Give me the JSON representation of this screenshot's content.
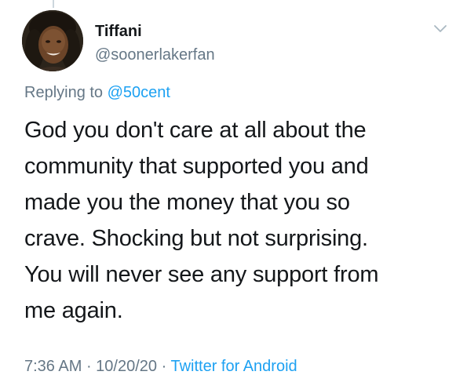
{
  "tweet": {
    "author": {
      "display_name": "Tiffani",
      "handle": "@soonerlakerfan",
      "avatar_icon": "profile-photo"
    },
    "menu_icon": "chevron-down-icon",
    "reply": {
      "prefix": "Replying to ",
      "mention": "@50cent"
    },
    "text_lines": [
      "God you don't care at all about the",
      "community that supported you and",
      "made you the money that you so",
      "crave. Shocking but not surprising.",
      "You will never see any support from",
      "me again."
    ],
    "time": "7:36 AM",
    "separator": " · ",
    "date": "10/20/20",
    "source": "Twitter for Android"
  },
  "colors": {
    "text_primary": "#14171a",
    "text_secondary": "#657786",
    "link_blue": "#1da1f2"
  }
}
